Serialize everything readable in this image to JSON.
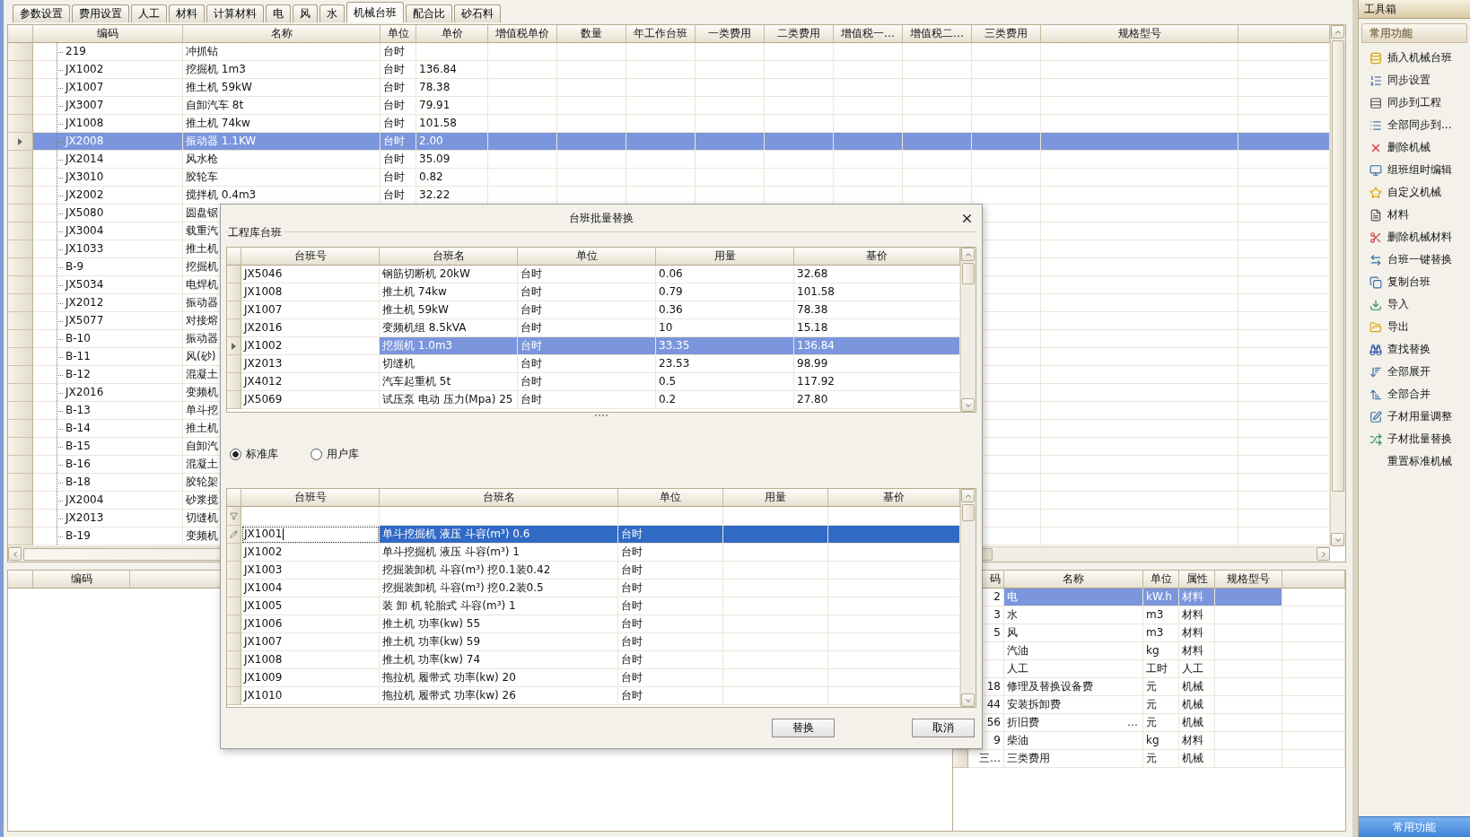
{
  "tabs": [
    {
      "label": "参数设置",
      "selected": false
    },
    {
      "label": "费用设置",
      "selected": false
    },
    {
      "label": "人工",
      "selected": false
    },
    {
      "label": "材料",
      "selected": false
    },
    {
      "label": "计算材料",
      "selected": false
    },
    {
      "label": "电",
      "selected": false
    },
    {
      "label": "风",
      "selected": false
    },
    {
      "label": "水",
      "selected": false
    },
    {
      "label": "机械台班",
      "selected": true
    },
    {
      "label": "配合比",
      "selected": false
    },
    {
      "label": "砂石料",
      "selected": false
    }
  ],
  "main_table": {
    "columns": [
      "编码",
      "名称",
      "单位",
      "单价",
      "增值税单价",
      "数量",
      "年工作台班",
      "一类费用",
      "二类费用",
      "增值税一…",
      "增值税二…",
      "三类费用",
      "规格型号"
    ],
    "rows": [
      {
        "code": "219",
        "name": "冲抓钻",
        "unit": "台时",
        "selected": false
      },
      {
        "code": "JX1002",
        "name": "挖掘机 1m3",
        "unit": "台时",
        "price": "136.84",
        "selected": false
      },
      {
        "code": "JX1007",
        "name": "推土机 59kW",
        "unit": "台时",
        "price": "78.38",
        "selected": false
      },
      {
        "code": "JX3007",
        "name": "自卸汽车 8t",
        "unit": "台时",
        "price": "79.91",
        "selected": false
      },
      {
        "code": "JX1008",
        "name": "推土机 74kw",
        "unit": "台时",
        "price": "101.58",
        "selected": false
      },
      {
        "code": "JX2008",
        "name": "振动器   1.1KW",
        "unit": "台时",
        "price": "2.00",
        "selected": true
      },
      {
        "code": "JX2014",
        "name": "风水枪",
        "unit": "台时",
        "price": "35.09",
        "selected": false
      },
      {
        "code": "JX3010",
        "name": "胶轮车",
        "unit": "台时",
        "price": "0.82",
        "selected": false
      },
      {
        "code": "JX2002",
        "name": "搅拌机 0.4m3",
        "unit": "台时",
        "price": "32.22",
        "selected": false
      },
      {
        "code": "JX5080",
        "name": "圆盘锯",
        "selected": false
      },
      {
        "code": "JX3004",
        "name": "载重汽",
        "selected": false
      },
      {
        "code": "JX1033",
        "name": "推土机",
        "selected": false
      },
      {
        "code": "B-9",
        "name": "挖掘机",
        "selected": false
      },
      {
        "code": "JX5034",
        "name": "电焊机",
        "selected": false
      },
      {
        "code": "JX2012",
        "name": "振动器",
        "selected": false
      },
      {
        "code": "JX5077",
        "name": "对接熔",
        "selected": false
      },
      {
        "code": "B-10",
        "name": "振动器",
        "selected": false
      },
      {
        "code": "B-11",
        "name": "风(砂)",
        "selected": false
      },
      {
        "code": "B-12",
        "name": "混凝土",
        "selected": false
      },
      {
        "code": "JX2016",
        "name": "变频机",
        "selected": false
      },
      {
        "code": "B-13",
        "name": "单斗挖",
        "selected": false
      },
      {
        "code": "B-14",
        "name": "推土机",
        "selected": false
      },
      {
        "code": "B-15",
        "name": "自卸汽",
        "selected": false
      },
      {
        "code": "B-16",
        "name": "混凝土",
        "selected": false
      },
      {
        "code": "B-18",
        "name": "胶轮架",
        "selected": false
      },
      {
        "code": "JX2004",
        "name": "砂浆搅",
        "selected": false
      },
      {
        "code": "JX2013",
        "name": "切缝机",
        "selected": false
      },
      {
        "code": "B-19",
        "name": "变频机",
        "selected": false
      }
    ]
  },
  "bottom_left_table": {
    "columns": [
      "编码"
    ]
  },
  "bottom_right_table": {
    "columns": [
      "码",
      "名称",
      "单位",
      "属性",
      "规格型号"
    ],
    "rows": [
      {
        "code": "2",
        "name": "电",
        "unit": "kW.h",
        "type": "材料",
        "selected": true
      },
      {
        "code": "3",
        "name": "水",
        "unit": "m3",
        "type": "材料",
        "selected": false
      },
      {
        "code": "5",
        "name": "风",
        "unit": "m3",
        "type": "材料",
        "selected": false
      },
      {
        "name": "汽油",
        "unit": "kg",
        "type": "材料",
        "selected": false
      },
      {
        "name": "人工",
        "unit": "工时",
        "type": "人工",
        "selected": false
      },
      {
        "code": "18",
        "name": "修理及替换设备费",
        "unit": "元",
        "type": "机械",
        "selected": false
      },
      {
        "code": "44",
        "name": "安装拆卸费",
        "unit": "元",
        "type": "机械",
        "selected": false
      },
      {
        "code": "56",
        "name": "折旧费",
        "more": "…",
        "unit": "元",
        "type": "机械",
        "selected": false
      },
      {
        "code": "9",
        "name": "柴油",
        "unit": "kg",
        "type": "材料",
        "selected": false
      },
      {
        "code": "三…",
        "name": "三类费用",
        "unit": "元",
        "type": "机械",
        "selected": false
      }
    ]
  },
  "toolbox": {
    "title": "工具箱",
    "group": "常用功能",
    "footer": "常用功能",
    "items": [
      {
        "label": "插入机械台班",
        "icon": true
      },
      {
        "label": "同步设置",
        "icon": true
      },
      {
        "label": "同步到工程",
        "icon": true
      },
      {
        "label": "全部同步到...",
        "icon": true
      },
      {
        "label": "删除机械",
        "icon": true
      },
      {
        "label": "组班组时编辑",
        "icon": true
      },
      {
        "label": "自定义机械",
        "icon": true
      },
      {
        "label": "材料",
        "icon": true
      },
      {
        "label": "删除机械材料",
        "icon": true
      },
      {
        "label": "台班一键替换",
        "icon": true
      },
      {
        "label": "复制台班",
        "icon": true
      },
      {
        "label": "导入",
        "icon": true
      },
      {
        "label": "导出",
        "icon": true
      },
      {
        "label": "查找替换",
        "icon": true
      },
      {
        "label": "全部展开",
        "icon": true
      },
      {
        "label": "全部合并",
        "icon": true
      },
      {
        "label": "子材用量调整",
        "icon": true
      },
      {
        "label": "子材批量替换",
        "icon": true
      },
      {
        "label": "重置标准机械",
        "icon": false
      }
    ]
  },
  "dialog": {
    "title": "台班批量替换",
    "group_label": "工程库台班",
    "upper_table": {
      "columns": [
        "台班号",
        "台班名",
        "单位",
        "用量",
        "基价"
      ],
      "rows": [
        {
          "code": "JX5046",
          "name": "钢筋切断机 20kW",
          "unit": "台时",
          "amount": "0.06",
          "price": "32.68",
          "selected": false
        },
        {
          "code": "JX1008",
          "name": "推土机 74kw",
          "unit": "台时",
          "amount": "0.79",
          "price": "101.58",
          "selected": false
        },
        {
          "code": "JX1007",
          "name": "推土机 59kW",
          "unit": "台时",
          "amount": "0.36",
          "price": "78.38",
          "selected": false
        },
        {
          "code": "JX2016",
          "name": "变频机组   8.5kVA",
          "unit": "台时",
          "amount": "10",
          "price": "15.18",
          "selected": false
        },
        {
          "code": "JX1002",
          "name": "挖掘机 1.0m3",
          "unit": "台时",
          "amount": "33.35",
          "price": "136.84",
          "selected": true
        },
        {
          "code": "JX2013",
          "name": "切缝机",
          "unit": "台时",
          "amount": "23.53",
          "price": "98.99",
          "selected": false
        },
        {
          "code": "JX4012",
          "name": "汽车起重机   5t",
          "unit": "台时",
          "amount": "0.5",
          "price": "117.92",
          "selected": false
        },
        {
          "code": "JX5069",
          "name": "试压泵 电动 压力(Mpa) 25",
          "unit": "台时",
          "amount": "0.2",
          "price": "27.80",
          "selected": false
        }
      ]
    },
    "radios": [
      {
        "label": "标准库",
        "selected": true
      },
      {
        "label": "用户库",
        "selected": false
      }
    ],
    "lower_table": {
      "columns": [
        "台班号",
        "台班名",
        "单位",
        "用量",
        "基价"
      ],
      "rows": [
        {
          "code": "JX1001",
          "name": "单斗挖掘机 液压 斗容(m³)  0.6",
          "unit": "台时",
          "selected": true,
          "editing": true
        },
        {
          "code": "JX1002",
          "name": "单斗挖掘机 液压 斗容(m³)  1",
          "unit": "台时",
          "selected": false,
          "editing": false
        },
        {
          "code": "JX1003",
          "name": "挖掘装卸机 斗容(m³)  挖0.1装0.42",
          "unit": "台时",
          "selected": false,
          "editing": false
        },
        {
          "code": "JX1004",
          "name": "挖掘装卸机 斗容(m³)  挖0.2装0.5",
          "unit": "台时",
          "selected": false,
          "editing": false
        },
        {
          "code": "JX1005",
          "name": "装 卸 机 轮胎式 斗容(m³)  1",
          "unit": "台时",
          "selected": false,
          "editing": false
        },
        {
          "code": "JX1006",
          "name": "推土机  功率(kw) 55",
          "unit": "台时",
          "selected": false,
          "editing": false
        },
        {
          "code": "JX1007",
          "name": "推土机  功率(kw) 59",
          "unit": "台时",
          "selected": false,
          "editing": false
        },
        {
          "code": "JX1008",
          "name": "推土机  功率(kw) 74",
          "unit": "台时",
          "selected": false,
          "editing": false
        },
        {
          "code": "JX1009",
          "name": "拖拉机 履带式 功率(kw) 20",
          "unit": "台时",
          "selected": false,
          "editing": false
        },
        {
          "code": "JX1010",
          "name": "拖拉机 履带式 功率(kw) 26",
          "unit": "台时",
          "selected": false,
          "editing": false
        }
      ]
    },
    "buttons": [
      "替换",
      "取消"
    ]
  }
}
